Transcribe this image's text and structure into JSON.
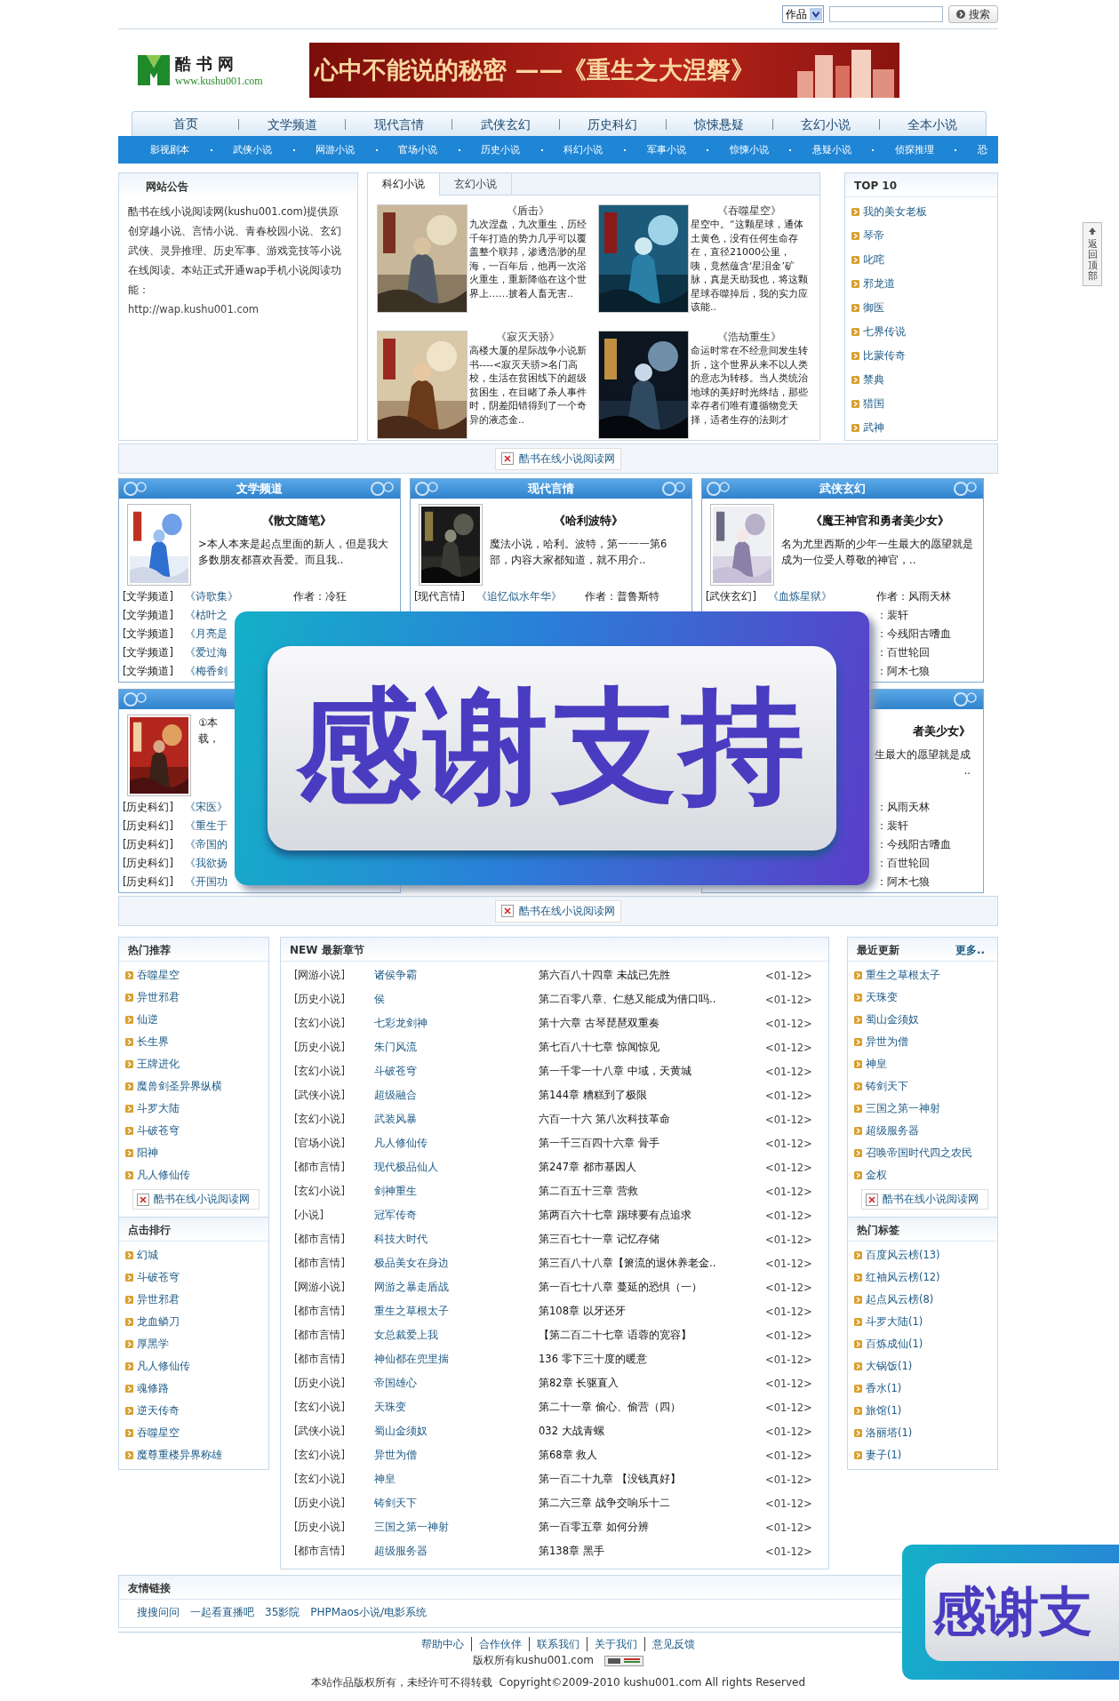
{
  "top_bar": {
    "search_scope": "作品",
    "search_button": "搜索"
  },
  "logo": {
    "name": "酷书网",
    "url": "www.kushu001.com"
  },
  "banner": {
    "text": "心中不能说的秘密 ——《重生之大涅磐》"
  },
  "nav": [
    "首页",
    "文学频道",
    "现代言情",
    "武侠玄幻",
    "历史科幻",
    "惊悚悬疑",
    "玄幻小说",
    "全本小说"
  ],
  "subnav": [
    "影视剧本",
    "武侠小说",
    "网游小说",
    "官场小说",
    "历史小说",
    "科幻小说",
    "军事小说",
    "惊悚小说",
    "悬疑小说",
    "侦探推理",
    "恐"
  ],
  "notice": {
    "title": "网站公告",
    "text": "酷书在线小说阅读网(kushu001.com)提供原创穿越小说、言情小说、青春校园小说、玄幻武侠、灵异推理、历史军事、游戏竞技等小说在线阅读。本站正式开通wap手机小说阅读功能：",
    "url": "http://wap.kushu001.com"
  },
  "featured": {
    "tabs": [
      {
        "label": "科幻小说",
        "selected": true
      },
      {
        "label": "玄幻小说",
        "selected": false
      }
    ],
    "books": [
      {
        "title": "《盾击》",
        "description": "九次涅盘，九次重生，历经千年打造的势力几乎可以覆盖整个联邦，渗透浩渺的星海，一百年后，他再一次浴火重生，重新降临在这个世界上……披着人畜无害.."
      },
      {
        "title": "《吞噬星空》",
        "description": "星空中。“这颗星球，通体土黄色，没有任何生命存在，直径21000公里，咦，竟然蕴含‘星泪金’矿脉，真是天助我也，将这颗星球吞噬掉后，我的实力应该能.."
      },
      {
        "title": "《寂灭天骄》",
        "description": "高楼大厦的星际战争小说新书----<寂灭天骄>名门高校，生活在贫困线下的超级贫困生，在目睹了杀人事件时，阴差阳错得到了一个奇异的液态金.."
      },
      {
        "title": "《浩劫重生》",
        "description": "命运时常在不经意间发生转折，这个世界从来不以人类的意志为转移。当人类统治地球的美好时光终结，那些幸存者们唯有遵循物竞天择，适者生存的法则才"
      }
    ]
  },
  "top10": {
    "title": "TOP 10",
    "items": [
      "我的美女老板",
      "琴帝",
      "叱咤",
      "邪龙道",
      "御医",
      "七界传说",
      "比蒙传奇",
      "禁典",
      "猎国",
      "武神"
    ]
  },
  "ad_bar": "酷书在线小说阅读网",
  "channels": [
    {
      "title": "文学频道",
      "cover": true,
      "book_title": "《散文随笔》",
      "description": ">本人本来是起点里面的新人，但是我大多数朋友都喜欢吾爱。而且我..",
      "lines": [
        {
          "category": "[文学频道]",
          "title": "《诗歌集》",
          "author": "作者：冷狂"
        },
        {
          "category": "[文学频道]",
          "title": "《枯叶之"
        },
        {
          "category": "[文学频道]",
          "title": "《月亮是"
        },
        {
          "category": "[文学频道]",
          "title": "《爱过海"
        },
        {
          "category": "[文学频道]",
          "title": "《梅香剑"
        }
      ]
    },
    {
      "title": "现代言情",
      "cover": true,
      "book_title": "《哈利波特》",
      "description": "魔法小说，哈利。波特，第一一一第6部，内容大家都知道，就不用介..",
      "lines": [
        {
          "category": "[现代言情]",
          "title": "《追忆似水年华》",
          "author": "作者：普鲁斯特"
        }
      ]
    },
    {
      "title": "武侠玄幻",
      "cover": true,
      "book_title": "《魔王神官和勇者美少女》",
      "description": "名为尤里西斯的少年一生最大的愿望就是成为一位受人尊敬的神官，..",
      "lines": [
        {
          "category": "[武侠玄幻]",
          "title": "《血炼星狱》",
          "author": "作者：风雨天林"
        },
        {
          "author": "：裴轩"
        },
        {
          "author": "：今残阳古嗜血"
        },
        {
          "author": "：百世轮回"
        },
        {
          "author": "：阿木七狼"
        }
      ]
    },
    {
      "cover": true,
      "description_lines": [
        "①本",
        "载，"
      ],
      "lines": [
        {
          "category": "[历史科幻]",
          "title": "《宋医》"
        },
        {
          "category": "[历史科幻]",
          "title": "《重生于"
        },
        {
          "category": "[历史科幻]",
          "title": "《帝国的"
        },
        {
          "category": "[历史科幻]",
          "title": "《我欲扬"
        },
        {
          "category": "[历史科幻]",
          "title": "《开国功"
        }
      ]
    },
    {
      "cover": false,
      "book_title": "者美少女》",
      "description_lines": [
        "生最大的愿望就是成",
        ".."
      ],
      "lines": [
        {
          "author": "：风雨天林"
        },
        {
          "author": "：裴轩"
        },
        {
          "author": "：今残阳古嗜血"
        },
        {
          "author": "：百世轮回"
        },
        {
          "author": "：阿木七狼"
        }
      ]
    }
  ],
  "popups": [
    {
      "text": "感谢支持"
    },
    {
      "text": "感谢支"
    }
  ],
  "ad_bar_2": "酷书在线小说阅读网",
  "hot_picks": {
    "title": "热门推荐",
    "items": [
      "吞噬星空",
      "异世邪君",
      "仙逆",
      "长生界",
      "王牌进化",
      "魔兽剑圣异界纵横",
      "斗罗大陆",
      "斗破苍穹",
      "阳神",
      "凡人修仙传"
    ],
    "ad": "酷书在线小说阅读网"
  },
  "click_rank": {
    "title": "点击排行",
    "items": [
      "幻城",
      "斗破苍穹",
      "异世邪君",
      "龙血鳞刀",
      "厚黑学",
      "凡人修仙传",
      "魂修路",
      "逆天传奇",
      "吞噬星空",
      "魔尊重楼异界称雄"
    ]
  },
  "latest_chapters": {
    "title": "NEW 最新章节",
    "rows": [
      {
        "category": "[网游小说]",
        "book": "诸侯争霸",
        "chapter": "第六百八十四章 未战已先胜",
        "date": "<01-12>"
      },
      {
        "category": "[历史小说]",
        "book": "侯",
        "chapter": "第二百零八章、仁慈又能成为借口吗..",
        "date": "<01-12>"
      },
      {
        "category": "[玄幻小说]",
        "book": "七彩龙剑神",
        "chapter": "第十六章 古琴琵琶双重奏",
        "date": "<01-12>"
      },
      {
        "category": "[历史小说]",
        "book": "朱门风流",
        "chapter": "第七百八十七章 惊闻惊见",
        "date": "<01-12>"
      },
      {
        "category": "[玄幻小说]",
        "book": "斗破苍穹",
        "chapter": "第一千零一十八章 中域，天黄城",
        "date": "<01-12>"
      },
      {
        "category": "[武侠小说]",
        "book": "超级融合",
        "chapter": "第144章 糟糕到了极限",
        "date": "<01-12>"
      },
      {
        "category": "[玄幻小说]",
        "book": "武装风暴",
        "chapter": "六百一十六 第八次科技革命",
        "date": "<01-12>"
      },
      {
        "category": "[官场小说]",
        "book": "凡人修仙传",
        "chapter": "第一千三百四十六章 骨手",
        "date": "<01-12>"
      },
      {
        "category": "[都市言情]",
        "book": "现代极品仙人",
        "chapter": "第247章 都市基因人",
        "date": "<01-12>"
      },
      {
        "category": "[玄幻小说]",
        "book": "剑神重生",
        "chapter": "第二百五十三章 营救",
        "date": "<01-12>"
      },
      {
        "category": "[小说]",
        "book": "冠军传奇",
        "chapter": "第两百六十七章 踢球要有点追求",
        "date": "<01-12>"
      },
      {
        "category": "[都市言情]",
        "book": "科技大时代",
        "chapter": "第三百七十一章 记忆存储",
        "date": "<01-12>"
      },
      {
        "category": "[都市言情]",
        "book": "极品美女在身边",
        "chapter": "第三百八十八章【箫流的退休养老金..",
        "date": "<01-12>"
      },
      {
        "category": "[网游小说]",
        "book": "网游之暴走盾战",
        "chapter": "第一百七十八章 蔓延的恐惧（一）",
        "date": "<01-12>"
      },
      {
        "category": "[都市言情]",
        "book": "重生之草根太子",
        "chapter": "第108章 以牙还牙",
        "date": "<01-12>"
      },
      {
        "category": "[都市言情]",
        "book": "女总裁爱上我",
        "chapter": "【第二百二十七章 语蓉的宽容】",
        "date": "<01-12>"
      },
      {
        "category": "[都市言情]",
        "book": "神仙都在兜里揣",
        "chapter": "136 零下三十度的暖意",
        "date": "<01-12>"
      },
      {
        "category": "[历史小说]",
        "book": "帝国雄心",
        "chapter": "第82章 长驱直入",
        "date": "<01-12>"
      },
      {
        "category": "[玄幻小说]",
        "book": "天珠变",
        "chapter": "第二十一章 偷心、偷营（四）",
        "date": "<01-12>"
      },
      {
        "category": "[武侠小说]",
        "book": "蜀山金须奴",
        "chapter": "032 大战青螺",
        "date": "<01-12>"
      },
      {
        "category": "[玄幻小说]",
        "book": "异世为僧",
        "chapter": "第68章 救人",
        "date": "<01-12>"
      },
      {
        "category": "[玄幻小说]",
        "book": "神皇",
        "chapter": "第一百二十九章 【没钱真好】",
        "date": "<01-12>"
      },
      {
        "category": "[历史小说]",
        "book": "铸剑天下",
        "chapter": "第二六三章 战争交响乐十二",
        "date": "<01-12>"
      },
      {
        "category": "[历史小说]",
        "book": "三国之第一神射",
        "chapter": "第一百零五章 如何分辨",
        "date": "<01-12>"
      },
      {
        "category": "[都市言情]",
        "book": "超级服务器",
        "chapter": "第138章 黑手",
        "date": "<01-12>"
      }
    ]
  },
  "recent_updates": {
    "title": "最近更新",
    "more": "更多..",
    "items": [
      "重生之草根太子",
      "天珠变",
      "蜀山金须奴",
      "异世为僧",
      "神皇",
      "铸剑天下",
      "三国之第一神射",
      "超级服务器",
      "召唤帝国时代四之农民",
      "金权"
    ],
    "ad": "酷书在线小说阅读网"
  },
  "hot_tags": {
    "title": "热门标签",
    "items": [
      "百度风云榜(13)",
      "红袖风云榜(12)",
      "起点风云榜(8)",
      "斗罗大陆(1)",
      "百炼成仙(1)",
      "大锅饭(1)",
      "香水(1)",
      "旅馆(1)",
      "洛丽塔(1)",
      "妻子(1)"
    ]
  },
  "friend_links": {
    "title": "友情链接",
    "items": [
      "搜搜问问",
      "一起看直播吧",
      "35影院",
      "PHPMaos小说/电影系统"
    ]
  },
  "footer": {
    "links": [
      "帮助中心",
      "合作伙伴",
      "联系我们",
      "关于我们",
      "意见反馈"
    ],
    "copyright_owner": "版权所有kushu001.com",
    "notice": "本站作品版权所有，未经许可不得转载  Copyright©2009-2010 kushu001.com All rights Reserved"
  },
  "back_to_top": "返回顶部"
}
